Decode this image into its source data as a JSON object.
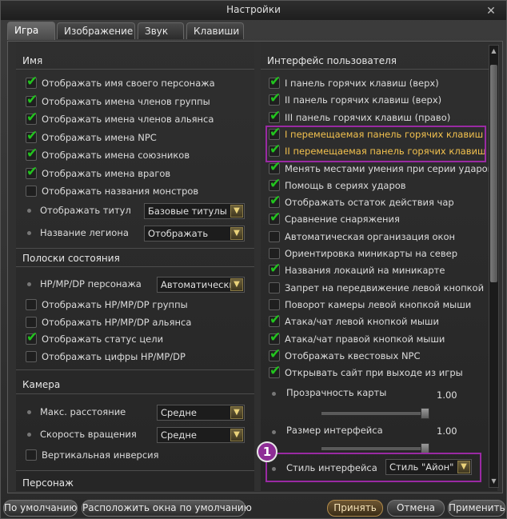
{
  "window": {
    "title": "Настройки"
  },
  "tabs": [
    "Игра",
    "Изображение",
    "Звук",
    "Клавиши"
  ],
  "left": {
    "name_section": "Имя",
    "name_checks": [
      {
        "label": "Отображать имя своего персонажа",
        "checked": true
      },
      {
        "label": "Отображать имена членов группы",
        "checked": true
      },
      {
        "label": "Отображать имена членов альянса",
        "checked": true
      },
      {
        "label": "Отображать имена NPC",
        "checked": true
      },
      {
        "label": "Отображать имена союзников",
        "checked": true
      },
      {
        "label": "Отображать имена врагов",
        "checked": true
      },
      {
        "label": "Отображать названия монстров",
        "checked": false
      }
    ],
    "title_label": "Отображать титул",
    "title_value": "Базовые титулы",
    "legion_label": "Название легиона",
    "legion_value": "Отображать",
    "status_section": "Полоски состояния",
    "hp_label": "HP/MP/DP персонажа",
    "hp_value": "Автоматически",
    "status_checks": [
      {
        "label": "Отображать HP/MP/DP группы",
        "checked": false
      },
      {
        "label": "Отображать HP/MP/DP альянса",
        "checked": false
      },
      {
        "label": "Отображать статус цели",
        "checked": true
      },
      {
        "label": "Отображать цифры HP/MP/DP",
        "checked": false
      }
    ],
    "camera_section": "Камера",
    "dist_label": "Макс. расстояние",
    "dist_value": "Средне",
    "rot_label": "Скорость вращения",
    "rot_value": "Средне",
    "invert_label": "Вертикальная инверсия",
    "invert_checked": false,
    "char_section": "Персонаж"
  },
  "right": {
    "ui_section": "Интерфейс пользователя",
    "checks": [
      {
        "label": "I панель горячих клавиш (верх)",
        "checked": true,
        "hl": false
      },
      {
        "label": "II панель горячих клавиш (верх)",
        "checked": true,
        "hl": false
      },
      {
        "label": "III панель горячих клавиш (право)",
        "checked": true,
        "hl": false
      },
      {
        "label": "I перемещаемая панель горячих клавиш",
        "checked": true,
        "hl": true
      },
      {
        "label": "II перемещаемая панель горячих клавиш",
        "checked": true,
        "hl": true
      },
      {
        "label": "Менять местами умения при серии ударов",
        "checked": true,
        "hl": false
      },
      {
        "label": "Помощь в сериях ударов",
        "checked": true,
        "hl": false
      },
      {
        "label": "Отображать остаток действия чар",
        "checked": true,
        "hl": false
      },
      {
        "label": "Сравнение снаряжения",
        "checked": true,
        "hl": false
      },
      {
        "label": "Автоматическая организация окон",
        "checked": false,
        "hl": false
      },
      {
        "label": "Ориентировка миникарты на север",
        "checked": false,
        "hl": false
      },
      {
        "label": "Названия локаций на миникарте",
        "checked": true,
        "hl": false
      },
      {
        "label": "Запрет на передвижение левой кнопкой",
        "checked": false,
        "hl": false
      },
      {
        "label": "Поворот камеры левой кнопкой мыши",
        "checked": false,
        "hl": false
      },
      {
        "label": "Атака/чат левой кнопкой мыши",
        "checked": true,
        "hl": false
      },
      {
        "label": "Атака/чат правой кнопкой мыши",
        "checked": true,
        "hl": false
      },
      {
        "label": "Отображать квестовых NPC",
        "checked": true,
        "hl": false
      },
      {
        "label": "Открывать сайт при выходе из игры",
        "checked": true,
        "hl": false
      }
    ],
    "map_opacity_label": "Прозрачность карты",
    "map_opacity_value": "1.00",
    "ui_size_label": "Размер интерфейса",
    "ui_size_value": "1.00",
    "style_label": "Стиль интерфейса",
    "style_value": "Стиль \"Айон\"",
    "badge": "1"
  },
  "buttons": {
    "default": "По умолчанию",
    "default_windows": "Расположить окна по умолчанию",
    "accept": "Принять",
    "cancel": "Отмена",
    "apply": "Применить"
  },
  "colors": {
    "highlight": "#9a2aa3",
    "check": "#22c51e",
    "label_highlight": "#f2c14e"
  }
}
